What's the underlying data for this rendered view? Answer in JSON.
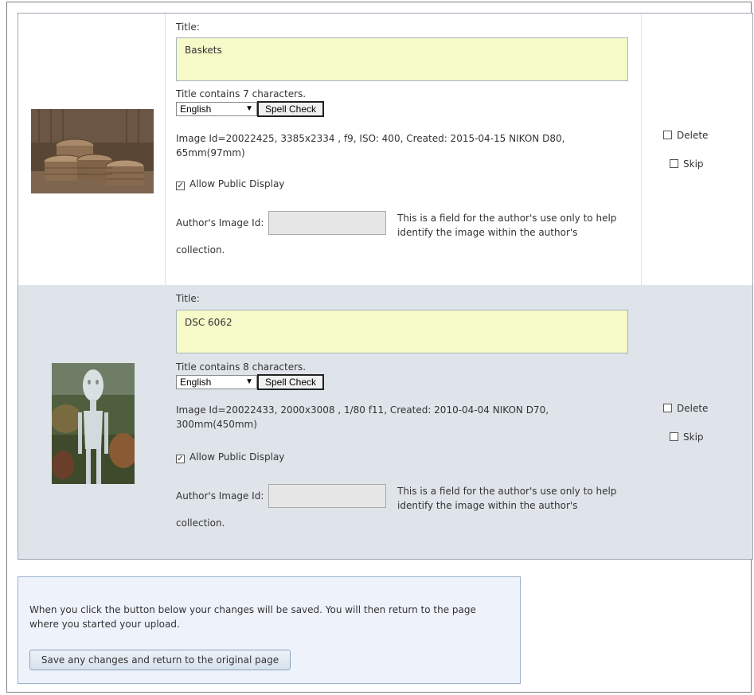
{
  "items": [
    {
      "title_label": "Title:",
      "title_value": "Baskets",
      "char_count": "Title contains 7 characters.",
      "language": "English",
      "spell_check": "Spell Check",
      "meta": "Image Id=20022425, 3385x2334 , f9, ISO: 400, Created: 2015-04-15 NIKON D80, 65mm(97mm)",
      "allow_public": "Allow Public Display",
      "allow_public_checked": true,
      "author_id_label": "Author's Image Id:",
      "author_id_value": "",
      "author_help": "This is a field for the author's use only to help identify the image within the author's",
      "author_help_cont": "collection.",
      "delete_label": "Delete",
      "skip_label": "Skip"
    },
    {
      "title_label": "Title:",
      "title_value": "DSC 6062",
      "char_count": "Title contains 8 characters.",
      "language": "English",
      "spell_check": "Spell Check",
      "meta": "Image Id=20022433, 2000x3008 , 1/80 f11, Created: 2010-04-04 NIKON D70, 300mm(450mm)",
      "allow_public": "Allow Public Display",
      "allow_public_checked": true,
      "author_id_label": "Author's Image Id:",
      "author_id_value": "",
      "author_help": "This is a field for the author's use only to help identify the image within the author's",
      "author_help_cont": "collection.",
      "delete_label": "Delete",
      "skip_label": "Skip"
    }
  ],
  "save": {
    "text": "When you click the button below your changes will be saved. You will then return to the page where you started your upload.",
    "button": "Save any changes and return to the original page"
  },
  "colors": {
    "title_bg": "#f6f9c8",
    "alt_row_bg": "#dfe4ea",
    "save_panel_bg": "#eef2fb"
  }
}
